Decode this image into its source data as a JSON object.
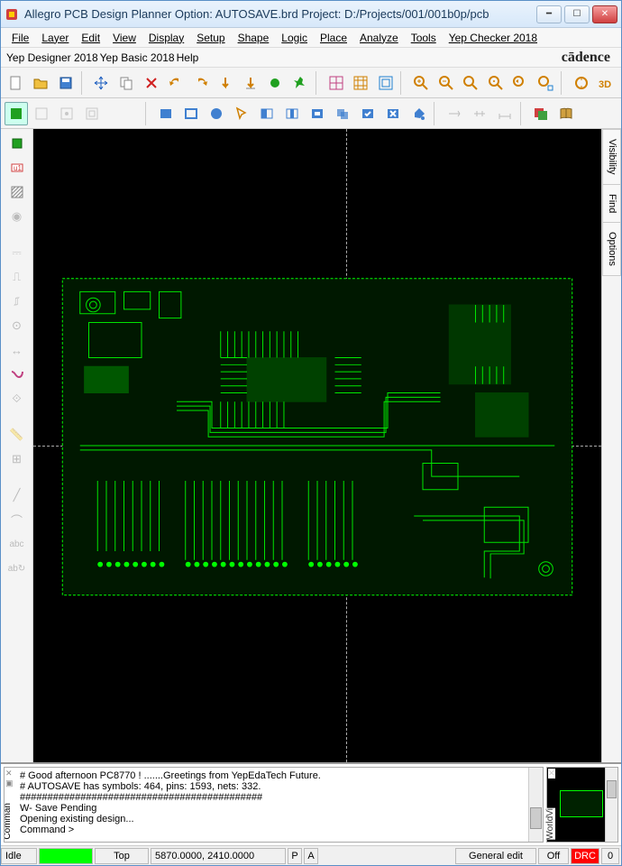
{
  "title": "Allegro PCB Design Planner Option: AUTOSAVE.brd  Project: D:/Projects/001/001b0p/pcb",
  "menu": {
    "row1": [
      "File",
      "Layer",
      "Edit",
      "View",
      "Display",
      "Setup",
      "Shape",
      "Logic",
      "Place",
      "Analyze",
      "Tools",
      "Yep Checker 2018"
    ],
    "row2": [
      "Yep Designer 2018",
      "Yep Basic 2018",
      "Help"
    ]
  },
  "brand": "cādence",
  "right_tabs": [
    "Visibility",
    "Find",
    "Options"
  ],
  "console": {
    "label": "Comman",
    "lines": [
      "#  Good afternoon PC8770 !      .......Greetings from YepEdaTech Future.",
      "#  AUTOSAVE has symbols: 464, pins: 1593, nets: 332.",
      "############################################",
      "W- Save Pending",
      "Opening existing design...",
      "Command >"
    ]
  },
  "worldview": {
    "label": "WorldVi"
  },
  "status": {
    "idle": "Idle",
    "layer": "Top",
    "coords": "5870.0000, 2410.0000",
    "p": "P",
    "a": "A",
    "mode": "General edit",
    "off": "Off",
    "drc": "DRC",
    "zero": "0"
  }
}
